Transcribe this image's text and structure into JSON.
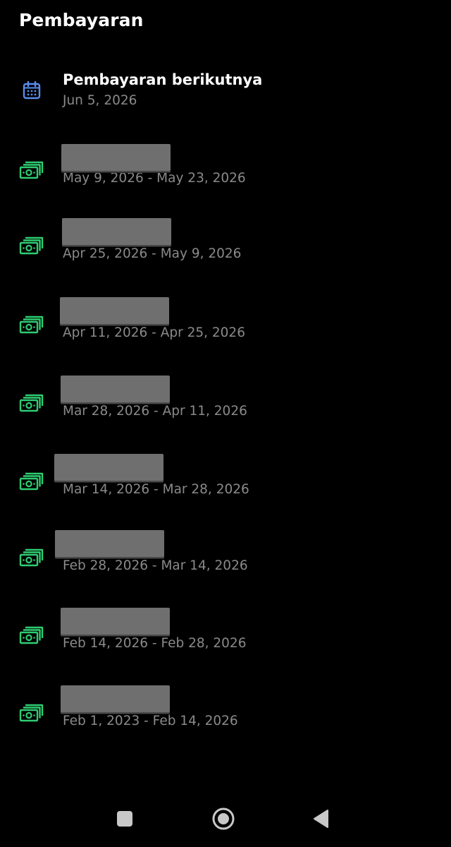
{
  "header": {
    "title": "Pembayaran"
  },
  "next_payment": {
    "icon": "calendar-icon",
    "title": "Pembayaran berikutnya",
    "date": "Jun 5, 2026"
  },
  "payments": [
    {
      "icon": "money-icon",
      "period": "May 9, 2026 - May 23, 2026",
      "amount_redacted": true
    },
    {
      "icon": "money-icon",
      "period": "Apr 25, 2026 - May 9, 2026",
      "amount_redacted": true
    },
    {
      "icon": "money-icon",
      "period": "Apr 11, 2026 - Apr 25, 2026",
      "amount_redacted": true
    },
    {
      "icon": "money-icon",
      "period": "Mar 28, 2026 - Apr 11, 2026",
      "amount_redacted": true
    },
    {
      "icon": "money-icon",
      "period": "Mar 14, 2026 - Mar 28, 2026",
      "amount_redacted": true
    },
    {
      "icon": "money-icon",
      "period": "Feb 28, 2026 - Mar 14, 2026",
      "amount_redacted": true
    },
    {
      "icon": "money-icon",
      "period": "Feb 14, 2026 - Feb 28, 2026",
      "amount_redacted": true
    },
    {
      "icon": "money-icon",
      "period": "Feb 1, 2023 - Feb 14, 2026",
      "amount_redacted": true
    }
  ],
  "nav_bar": {
    "buttons": [
      "recents-icon",
      "home-icon",
      "back-icon"
    ]
  },
  "colors": {
    "background": "#000000",
    "calendar": "#5b8def",
    "money": "#2ecc71",
    "subtext": "#8a8a8a",
    "redaction": "#6f6f6f"
  }
}
